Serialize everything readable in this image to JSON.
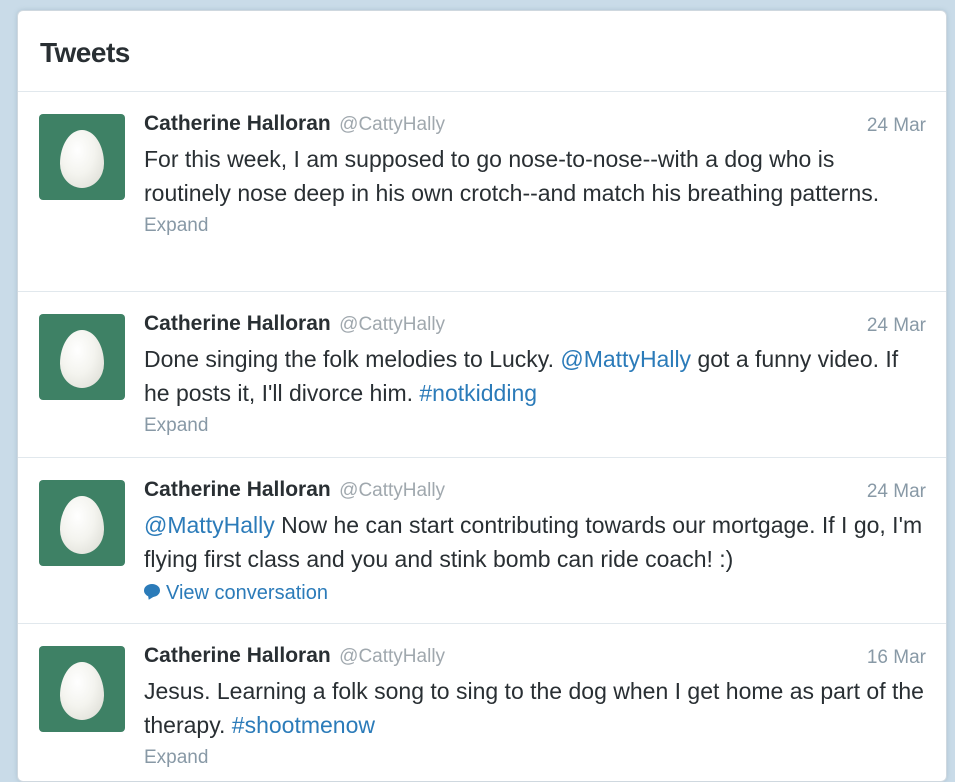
{
  "header": {
    "title": "Tweets"
  },
  "tweets": [
    {
      "fullname": "Catherine Halloran",
      "username": "@CattyHally",
      "time": "24 Mar",
      "text_parts": [
        {
          "t": "For this week, I am supposed to go nose-to-nose--with a dog who is routinely nose deep in his own crotch--and match his breathing patterns."
        }
      ],
      "action": "Expand"
    },
    {
      "fullname": "Catherine Halloran",
      "username": "@CattyHally",
      "time": "24 Mar",
      "text_parts": [
        {
          "t": "Done singing the folk melodies to Lucky. "
        },
        {
          "t": "@MattyHally",
          "link": true
        },
        {
          "t": " got a funny video. If he posts it, I'll divorce him. "
        },
        {
          "t": "#notkidding",
          "link": true
        }
      ],
      "action": "Expand"
    },
    {
      "fullname": "Catherine Halloran",
      "username": "@CattyHally",
      "time": "24 Mar",
      "text_parts": [
        {
          "t": "@MattyHally",
          "link": true
        },
        {
          "t": " Now he can start contributing towards our mortgage. If I go, I'm flying first class and you and stink bomb can ride coach! :)"
        }
      ],
      "conversation": "View conversation"
    },
    {
      "fullname": "Catherine Halloran",
      "username": "@CattyHally",
      "time": "16 Mar",
      "text_parts": [
        {
          "t": "Jesus. Learning a folk song to sing to the dog when I get home as part of the therapy. "
        },
        {
          "t": "#shootmenow",
          "link": true
        }
      ],
      "action": "Expand"
    }
  ],
  "colors": {
    "avatar_bg": "#3e8165",
    "link": "#2b7bb9",
    "text": "#292f33",
    "muted": "#8899a6",
    "page_bg": "#c9dbe8"
  },
  "icons": {
    "avatar": "egg-avatar-icon",
    "conversation": "speech-bubble-icon"
  }
}
